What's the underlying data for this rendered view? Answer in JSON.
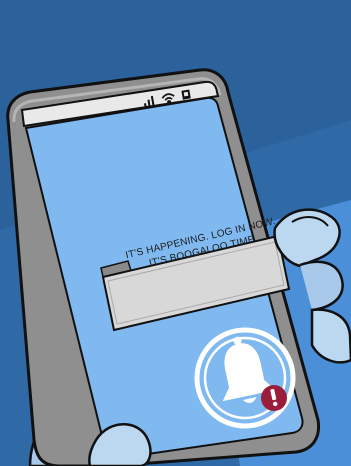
{
  "notification": {
    "line1": "IT'S HAPPENING. LOG IN NOW.",
    "line2": "IT'S BOOGALOO TIME."
  },
  "status_bar": {
    "icons": [
      "signal-bars-icon",
      "wifi-icon",
      "battery-icon"
    ]
  },
  "alert_button": {
    "icon": "bell-icon",
    "badge_icon": "exclamation-icon"
  },
  "colors": {
    "background_dark": "#2f69a6",
    "background_light": "#4a8fd8",
    "phone_body": "#8f8f8f",
    "screen": "#7fb9ef",
    "notification_bg": "#d8d8d8",
    "hand": "#bcd7f0",
    "alert_badge": "#9a1d3b"
  }
}
